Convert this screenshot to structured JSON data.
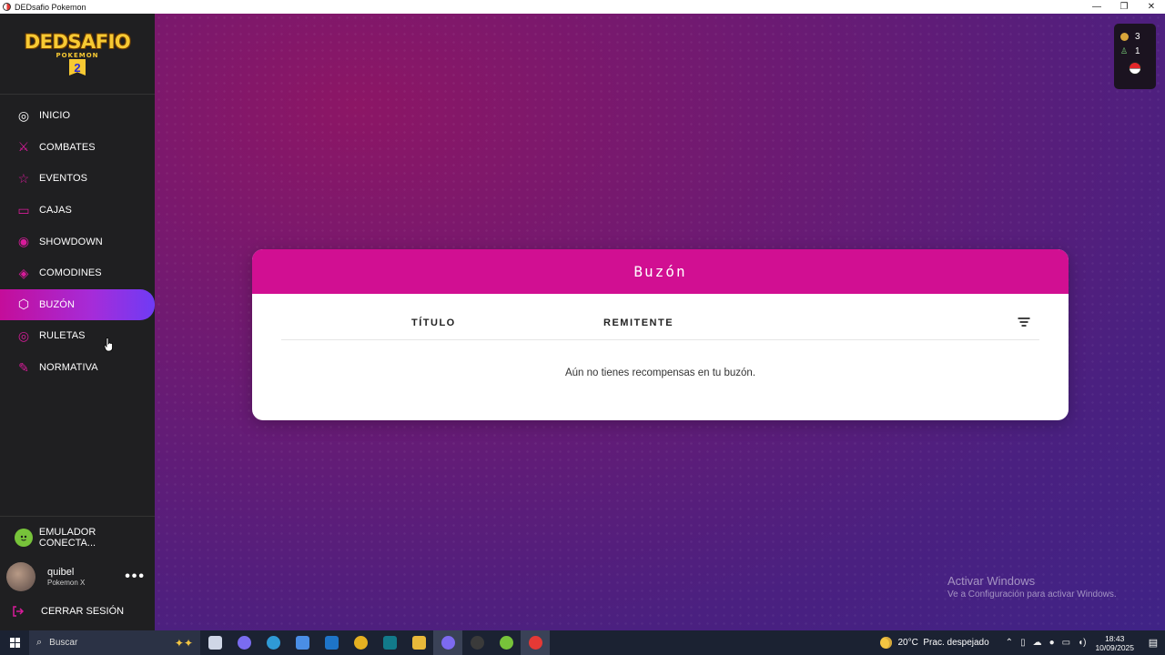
{
  "window": {
    "title": "DEDsafio Pokemon",
    "minimize": "—",
    "restore": "❐",
    "close": "✕"
  },
  "logo": {
    "line1": "DEDSAFIO",
    "line2": "POKEMON",
    "line3": "2"
  },
  "nav": {
    "items": [
      {
        "label": "INICIO",
        "icon": "pokeball-icon",
        "glyph": "◎",
        "color": "#ffffff"
      },
      {
        "label": "COMBATES",
        "icon": "battle-icon",
        "glyph": "⚔",
        "color": "#d81b9a"
      },
      {
        "label": "EVENTOS",
        "icon": "star-icon",
        "glyph": "☆",
        "color": "#d81b9a"
      },
      {
        "label": "CAJAS",
        "icon": "monitor-icon",
        "glyph": "▭",
        "color": "#d81b9a"
      },
      {
        "label": "SHOWDOWN",
        "icon": "showdown-icon",
        "glyph": "◉",
        "color": "#d81b9a"
      },
      {
        "label": "COMODINES",
        "icon": "wildcard-icon",
        "glyph": "◈",
        "color": "#d81b9a"
      },
      {
        "label": "BUZÓN",
        "icon": "box-icon",
        "glyph": "⬡",
        "color": "#ffffff"
      },
      {
        "label": "RULETAS",
        "icon": "roulette-icon",
        "glyph": "◎",
        "color": "#d81b9a"
      },
      {
        "label": "NORMATIVA",
        "icon": "edit-icon",
        "glyph": "✎",
        "color": "#d81b9a"
      }
    ],
    "active_index": 6
  },
  "emulator": {
    "label": "EMULADOR CONECTA..."
  },
  "user": {
    "name": "quibel",
    "game": "Pokemon X",
    "menu": "•••"
  },
  "logout": {
    "label": "CERRAR SESIÓN"
  },
  "stats": {
    "coins": "3",
    "people": "1"
  },
  "mailbox": {
    "title": "Buzón",
    "columns": [
      "TÍTULO",
      "REMITENTE"
    ],
    "empty_message": "Aún no tienes recompensas en tu buzón."
  },
  "watermark": {
    "line1": "Activar Windows",
    "line2": "Ve a Configuración para activar Windows."
  },
  "taskbar": {
    "search_placeholder": "Buscar",
    "apps": [
      {
        "name": "task-view-icon",
        "color": "#cfd6e6",
        "active": false
      },
      {
        "name": "copilot-icon",
        "color": "#7a6cf0",
        "active": false
      },
      {
        "name": "edge-icon",
        "color": "#2f9ad6",
        "active": false
      },
      {
        "name": "store-icon",
        "color": "#4a8ee6",
        "active": false
      },
      {
        "name": "outlook-icon",
        "color": "#1e74c8",
        "active": false
      },
      {
        "name": "chrome-icon",
        "color": "#e5b021",
        "active": false
      },
      {
        "name": "vegas-icon",
        "color": "#127a8a",
        "active": false
      },
      {
        "name": "explorer-icon",
        "color": "#e8b83a",
        "active": false
      },
      {
        "name": "discord-icon",
        "color": "#7d6af0",
        "active": true
      },
      {
        "name": "obs-icon",
        "color": "#3a3a3a",
        "active": false
      },
      {
        "name": "emulator-icon",
        "color": "#77c33a",
        "active": false
      },
      {
        "name": "dedsafio-icon",
        "color": "#e53935",
        "active": true
      }
    ],
    "weather": {
      "temp": "20°C",
      "desc": "Prac. despejado"
    },
    "time": "18:43",
    "date": "10/09/2025"
  }
}
